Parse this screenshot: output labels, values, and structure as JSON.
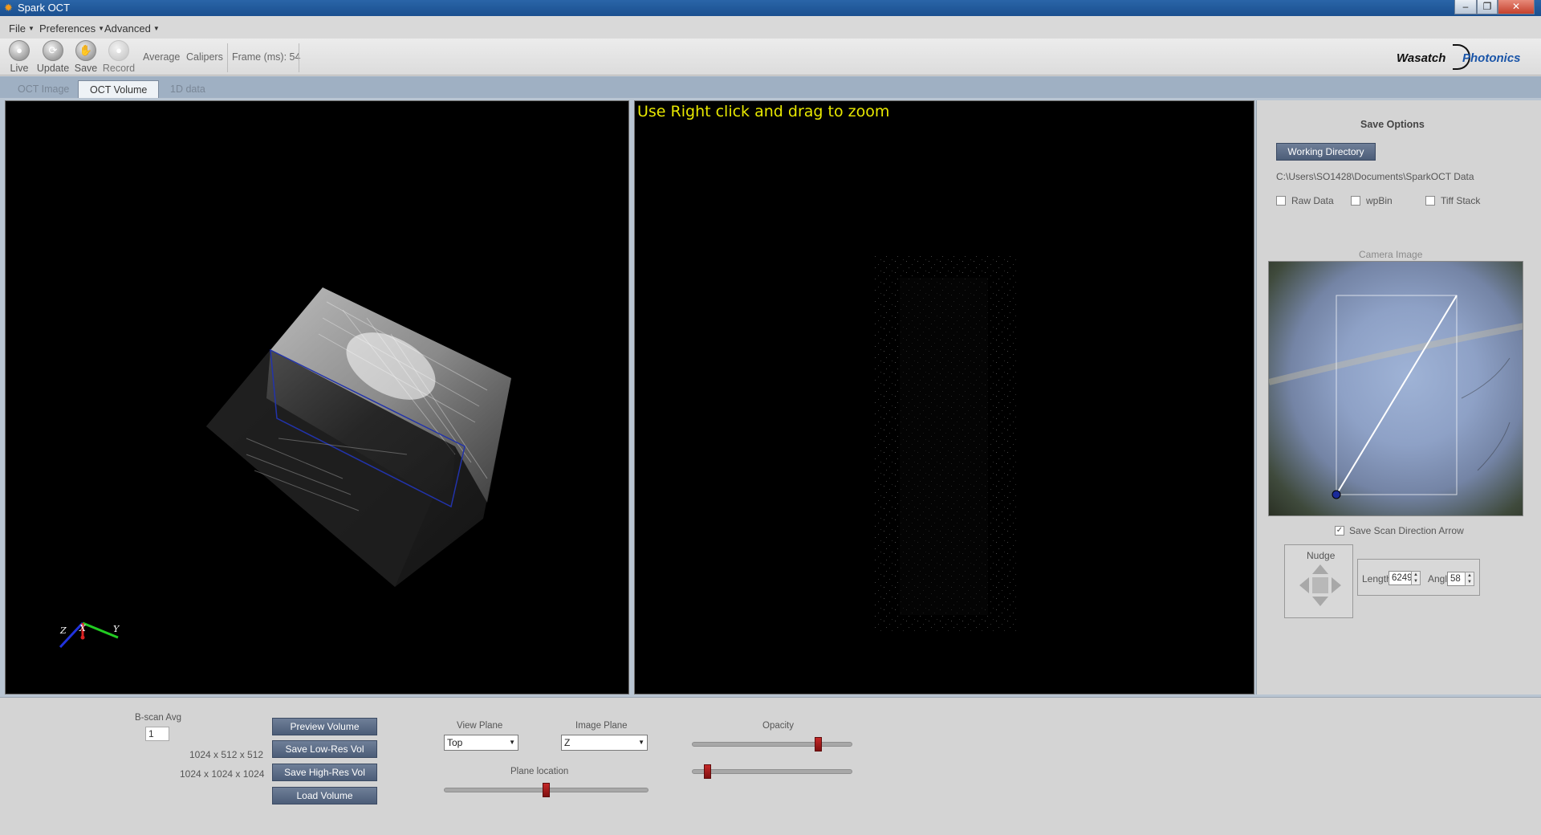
{
  "window": {
    "title": "Spark OCT",
    "controls": [
      "–",
      "❐",
      "✕"
    ]
  },
  "menu": [
    "File",
    "Preferences",
    "Advanced"
  ],
  "toolbar": {
    "buttons": [
      {
        "label": "Live",
        "icon": "camera-icon"
      },
      {
        "label": "Update",
        "icon": "refresh-icon"
      },
      {
        "label": "Save",
        "icon": "save-icon"
      },
      {
        "label": "Record",
        "icon": "record-icon"
      }
    ],
    "average_label": "Average",
    "calipers_label": "Calipers",
    "frame_label": "Frame (ms): 54",
    "logo_part1": "Wasatch",
    "logo_part2": "Photonics"
  },
  "tabs": [
    {
      "label": "OCT Image",
      "active": false
    },
    {
      "label": "OCT Volume",
      "active": true
    },
    {
      "label": "1D data",
      "active": false
    }
  ],
  "viewer": {
    "zoom_hint": "Use Right click and drag to zoom",
    "axes": {
      "z": "Z",
      "x": "X",
      "y": "Y"
    }
  },
  "save_options": {
    "title": "Save Options",
    "working_dir_button": "Working Directory",
    "path": "C:\\Users\\SO1428\\Documents\\SparkOCT Data",
    "checkboxes": [
      {
        "label": "Raw Data",
        "checked": false
      },
      {
        "label": "wpBin",
        "checked": false
      },
      {
        "label": "Tiff Stack",
        "checked": false
      }
    ]
  },
  "camera": {
    "title": "Camera Image",
    "save_arrow_label": "Save Scan Direction Arrow",
    "save_arrow_checked": true
  },
  "nudge": {
    "title": "Nudge",
    "length_label": "Length",
    "length_value": "6249",
    "angle_label": "Angle",
    "angle_value": "58"
  },
  "bottom": {
    "bscan_label": "B-scan Avg",
    "bscan_value": "1",
    "lowres_dims": "1024 x 512 x 512",
    "highres_dims": "1024 x 1024 x 1024",
    "preview_button": "Preview Volume",
    "save_lowres_button": "Save Low-Res Vol",
    "save_highres_button": "Save High-Res Vol",
    "load_button": "Load Volume",
    "view_plane_label": "View Plane",
    "view_plane_value": "Top",
    "image_plane_label": "Image Plane",
    "image_plane_value": "Z",
    "plane_location_label": "Plane location",
    "plane_location_level": 0.5,
    "opacity_label": "Opacity",
    "opacity_level": 0.8,
    "opacity2_level": 0.08
  }
}
